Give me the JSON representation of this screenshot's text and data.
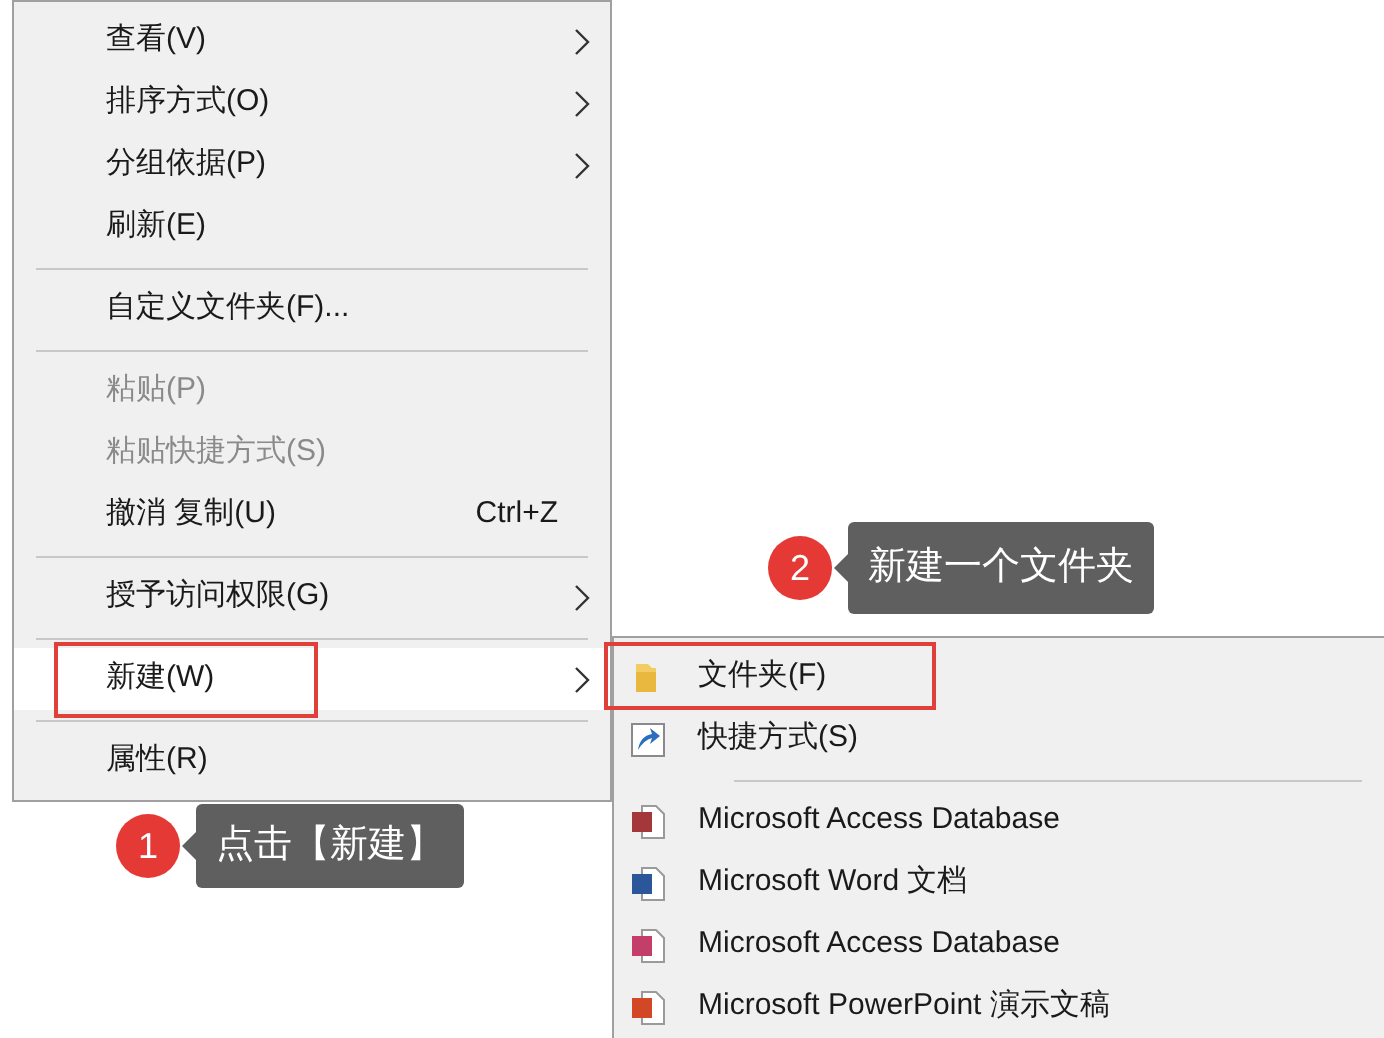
{
  "context_menu": {
    "items": [
      {
        "kind": "item",
        "label": "查看(V)",
        "has_submenu": true,
        "disabled": false,
        "selected": false,
        "annotated": false
      },
      {
        "kind": "item",
        "label": "排序方式(O)",
        "has_submenu": true,
        "disabled": false,
        "selected": false,
        "annotated": false
      },
      {
        "kind": "item",
        "label": "分组依据(P)",
        "has_submenu": true,
        "disabled": false,
        "selected": false,
        "annotated": false
      },
      {
        "kind": "item",
        "label": "刷新(E)",
        "has_submenu": false,
        "disabled": false,
        "selected": false,
        "annotated": false
      },
      {
        "kind": "separator"
      },
      {
        "kind": "item",
        "label": "自定义文件夹(F)...",
        "has_submenu": false,
        "disabled": false,
        "selected": false,
        "annotated": false
      },
      {
        "kind": "separator"
      },
      {
        "kind": "item",
        "label": "粘贴(P)",
        "has_submenu": false,
        "disabled": true,
        "selected": false,
        "annotated": false
      },
      {
        "kind": "item",
        "label": "粘贴快捷方式(S)",
        "has_submenu": false,
        "disabled": true,
        "selected": false,
        "annotated": false
      },
      {
        "kind": "item",
        "label": "撤消 复制(U)",
        "shortcut": "Ctrl+Z",
        "has_submenu": false,
        "disabled": false,
        "selected": false,
        "annotated": false
      },
      {
        "kind": "separator"
      },
      {
        "kind": "item",
        "label": "授予访问权限(G)",
        "has_submenu": true,
        "disabled": false,
        "selected": false,
        "annotated": false
      },
      {
        "kind": "separator"
      },
      {
        "kind": "item",
        "label": "新建(W)",
        "has_submenu": true,
        "disabled": false,
        "selected": true,
        "annotated": true
      },
      {
        "kind": "separator"
      },
      {
        "kind": "item",
        "label": "属性(R)",
        "has_submenu": false,
        "disabled": false,
        "selected": false,
        "annotated": false
      }
    ]
  },
  "submenu": {
    "items": [
      {
        "kind": "folder",
        "label": "文件夹(F)",
        "annotated": true
      },
      {
        "kind": "shortcut",
        "label": "快捷方式(S)",
        "annotated": false
      },
      {
        "kind": "separator"
      },
      {
        "kind": "file",
        "label": "Microsoft Access Database",
        "color": "#a4373a",
        "annotated": false
      },
      {
        "kind": "file",
        "label": "Microsoft Word 文档",
        "color": "#2b579a",
        "annotated": false
      },
      {
        "kind": "file",
        "label": "Microsoft Access Database",
        "color": "#c43e6a",
        "annotated": false
      },
      {
        "kind": "file",
        "label": "Microsoft PowerPoint 演示文稿",
        "color": "#d24726",
        "annotated": false
      }
    ]
  },
  "callouts": [
    {
      "number": "1",
      "text": "点击【新建】"
    },
    {
      "number": "2",
      "text": "新建一个文件夹"
    }
  ]
}
